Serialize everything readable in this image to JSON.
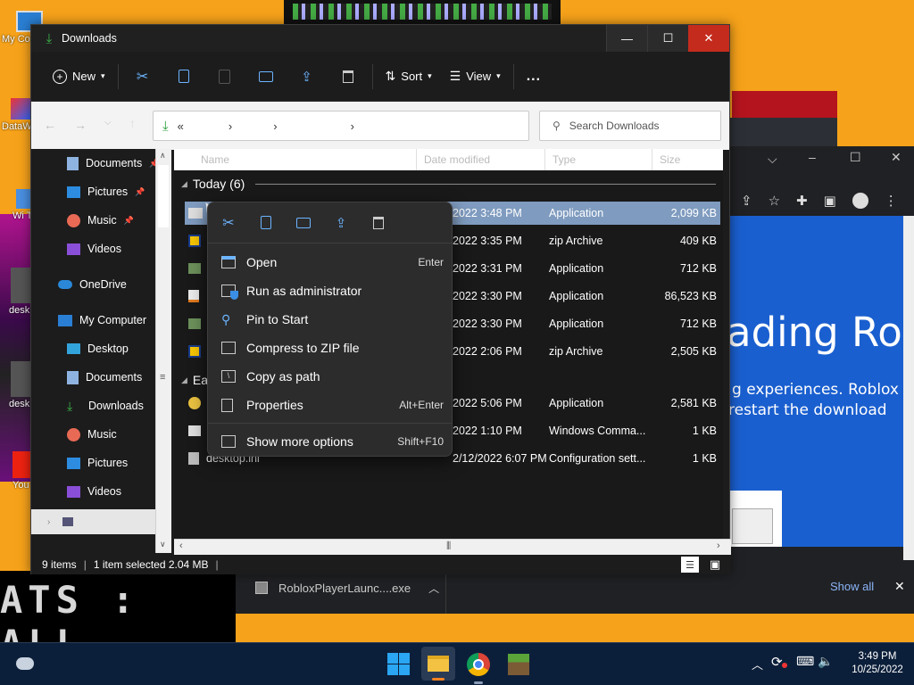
{
  "desktop": {
    "icons": [
      {
        "label": "My Co"
      },
      {
        "label": "DataW"
      },
      {
        "label": "Wi Tw"
      },
      {
        "label": "desk"
      },
      {
        "label": "desk"
      },
      {
        "label": "You"
      }
    ],
    "pixel_text": "ATS : ALL"
  },
  "explorer": {
    "title": "Downloads",
    "controls": {
      "minimize": "—",
      "maximize": "☐",
      "close": "✕"
    },
    "commandbar": {
      "new_label": "New",
      "sort_label": "Sort",
      "view_label": "View",
      "more_label": "..."
    },
    "address": {
      "prefix": "«",
      "chevrons": [
        "›",
        "›",
        "›"
      ]
    },
    "search": {
      "placeholder": "Search Downloads"
    },
    "navpane": {
      "items": [
        {
          "label": "Documents",
          "pinned": true
        },
        {
          "label": "Pictures",
          "pinned": true
        },
        {
          "label": "Music",
          "pinned": true
        },
        {
          "label": "Videos",
          "pinned": false
        },
        {
          "label": "OneDrive",
          "pinned": false
        },
        {
          "label": "My Computer",
          "pinned": false
        },
        {
          "label": "Desktop",
          "pinned": false
        },
        {
          "label": "Documents",
          "pinned": false
        },
        {
          "label": "Downloads",
          "pinned": false
        },
        {
          "label": "Music",
          "pinned": false
        },
        {
          "label": "Pictures",
          "pinned": false
        },
        {
          "label": "Videos",
          "pinned": false
        }
      ],
      "pin_glyph": "📌"
    },
    "columns": {
      "name": "Name",
      "date": "Date modified",
      "type": "Type",
      "size": "Size"
    },
    "groups": {
      "today": "Today (6)",
      "earlier": "Ea"
    },
    "files_today": [
      {
        "date": "2022 3:48 PM",
        "type": "Application",
        "size": "2,099 KB",
        "selected": true
      },
      {
        "date": "2022 3:35 PM",
        "type": "zip Archive",
        "size": "409 KB"
      },
      {
        "date": "2022 3:31 PM",
        "type": "Application",
        "size": "712 KB"
      },
      {
        "date": "2022 3:30 PM",
        "type": "Application",
        "size": "86,523 KB"
      },
      {
        "date": "2022 3:30 PM",
        "type": "Application",
        "size": "712 KB"
      },
      {
        "date": "2022 2:06 PM",
        "type": "zip Archive",
        "size": "2,505 KB"
      }
    ],
    "files_earlier": [
      {
        "name": "",
        "date": "2022 5:06 PM",
        "type": "Application",
        "size": "2,581 KB"
      },
      {
        "name": "",
        "date": "2022 1:10 PM",
        "type": "Windows Comma...",
        "size": "1 KB"
      },
      {
        "name": "desktop.ini",
        "date": "2/12/2022 6:07 PM",
        "type": "Configuration sett...",
        "size": "1 KB"
      }
    ],
    "status": {
      "items": "9 items",
      "selected": "1 item selected  2.04 MB"
    }
  },
  "context_menu": {
    "items": [
      {
        "label": "Open",
        "shortcut": "Enter"
      },
      {
        "label": "Run as administrator",
        "shortcut": ""
      },
      {
        "label": "Pin to Start",
        "shortcut": ""
      },
      {
        "label": "Compress to ZIP file",
        "shortcut": ""
      },
      {
        "label": "Copy as path",
        "shortcut": ""
      },
      {
        "label": "Properties",
        "shortcut": "Alt+Enter"
      }
    ],
    "more": {
      "label": "Show more options",
      "shortcut": "Shift+F10"
    }
  },
  "chrome": {
    "banner_title": "ading Ro",
    "banner_line1": "g experiences. Roblox",
    "banner_line2": "restart the download"
  },
  "download_bar": {
    "file": "RobloxPlayerLaunc....exe",
    "show_all": "Show all",
    "close": "✕"
  },
  "taskbar": {
    "time": "3:49 PM",
    "date": "10/25/2022"
  },
  "colors": {
    "accent": "#0067c0",
    "selection": "#7f9bbf",
    "chrome_blue": "#1a5fcf",
    "desktop": "#f6a21a"
  }
}
